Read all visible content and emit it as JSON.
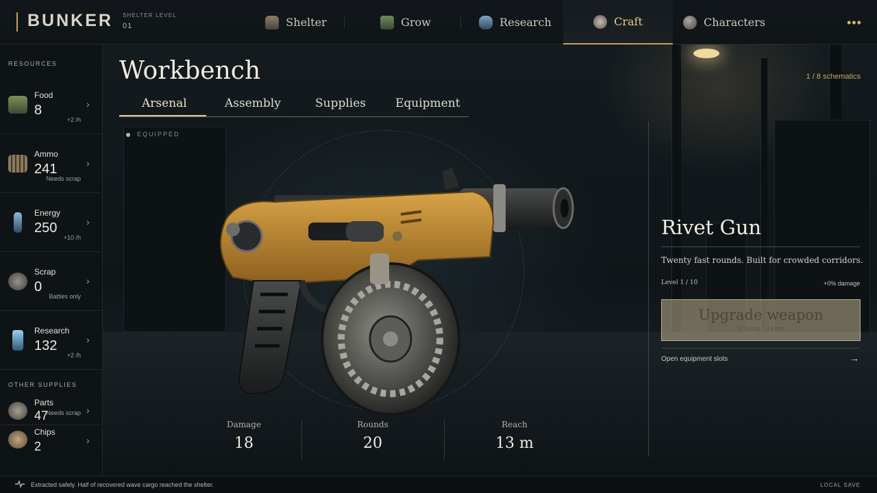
{
  "brand": "BUNKER",
  "shelter": {
    "label": "SHELTER LEVEL",
    "value": "01"
  },
  "nav": [
    {
      "label": "Shelter",
      "icon": "shelter-icon"
    },
    {
      "label": "Grow",
      "icon": "grow-icon"
    },
    {
      "label": "Research",
      "icon": "research-icon"
    },
    {
      "label": "Craft",
      "icon": "craft-icon",
      "active": true
    },
    {
      "label": "Characters",
      "icon": "characters-icon"
    }
  ],
  "more": "•••",
  "sidebar": {
    "resources_title": "RESOURCES",
    "resources": [
      {
        "name": "Food",
        "value": "8",
        "sub": "+2 /h",
        "icon": "food-icon"
      },
      {
        "name": "Ammo",
        "value": "241",
        "sub": "Needs scrap",
        "icon": "ammo-icon"
      },
      {
        "name": "Energy",
        "value": "250",
        "sub": "+10 /h",
        "icon": "energy-icon"
      },
      {
        "name": "Scrap",
        "value": "0",
        "sub": "Battles only",
        "icon": "scrap-icon"
      },
      {
        "name": "Research",
        "value": "132",
        "sub": "+2 /h",
        "icon": "research-vial-icon"
      }
    ],
    "other_title": "OTHER SUPPLIES",
    "other": [
      {
        "name": "Parts",
        "value": "47",
        "sub": "Needs scrap",
        "icon": "parts-icon"
      },
      {
        "name": "Chips",
        "value": "2",
        "sub": "",
        "icon": "chips-icon"
      }
    ]
  },
  "workbench": {
    "title": "Workbench",
    "counter": "1 / 8 schematics",
    "tabs": [
      "Arsenal",
      "Assembly",
      "Supplies",
      "Equipment"
    ],
    "active_tab": "Arsenal",
    "equipped": "EQUIPPED"
  },
  "weapon": {
    "name": "Rivet Gun",
    "description": "Twenty fast rounds. Built for crowded corridors.",
    "level": "Level 1 / 10",
    "damage_bonus": "+0% damage",
    "upgrade_label": "Upgrade weapon",
    "upgrade_cost": "30 scrap · 4 parts",
    "slots_label": "Open equipment slots",
    "stats": [
      {
        "label": "Damage",
        "value": "18"
      },
      {
        "label": "Rounds",
        "value": "20"
      },
      {
        "label": "Reach",
        "value": "13 m"
      }
    ]
  },
  "status": {
    "message": "Extracted safely. Half of recovered wave cargo reached the shelter.",
    "save": "LOCAL SAVE"
  },
  "colors": {
    "accent": "#c9a15a",
    "active_tab": "#e5c88e",
    "weapon_body": "#c08a2c"
  }
}
